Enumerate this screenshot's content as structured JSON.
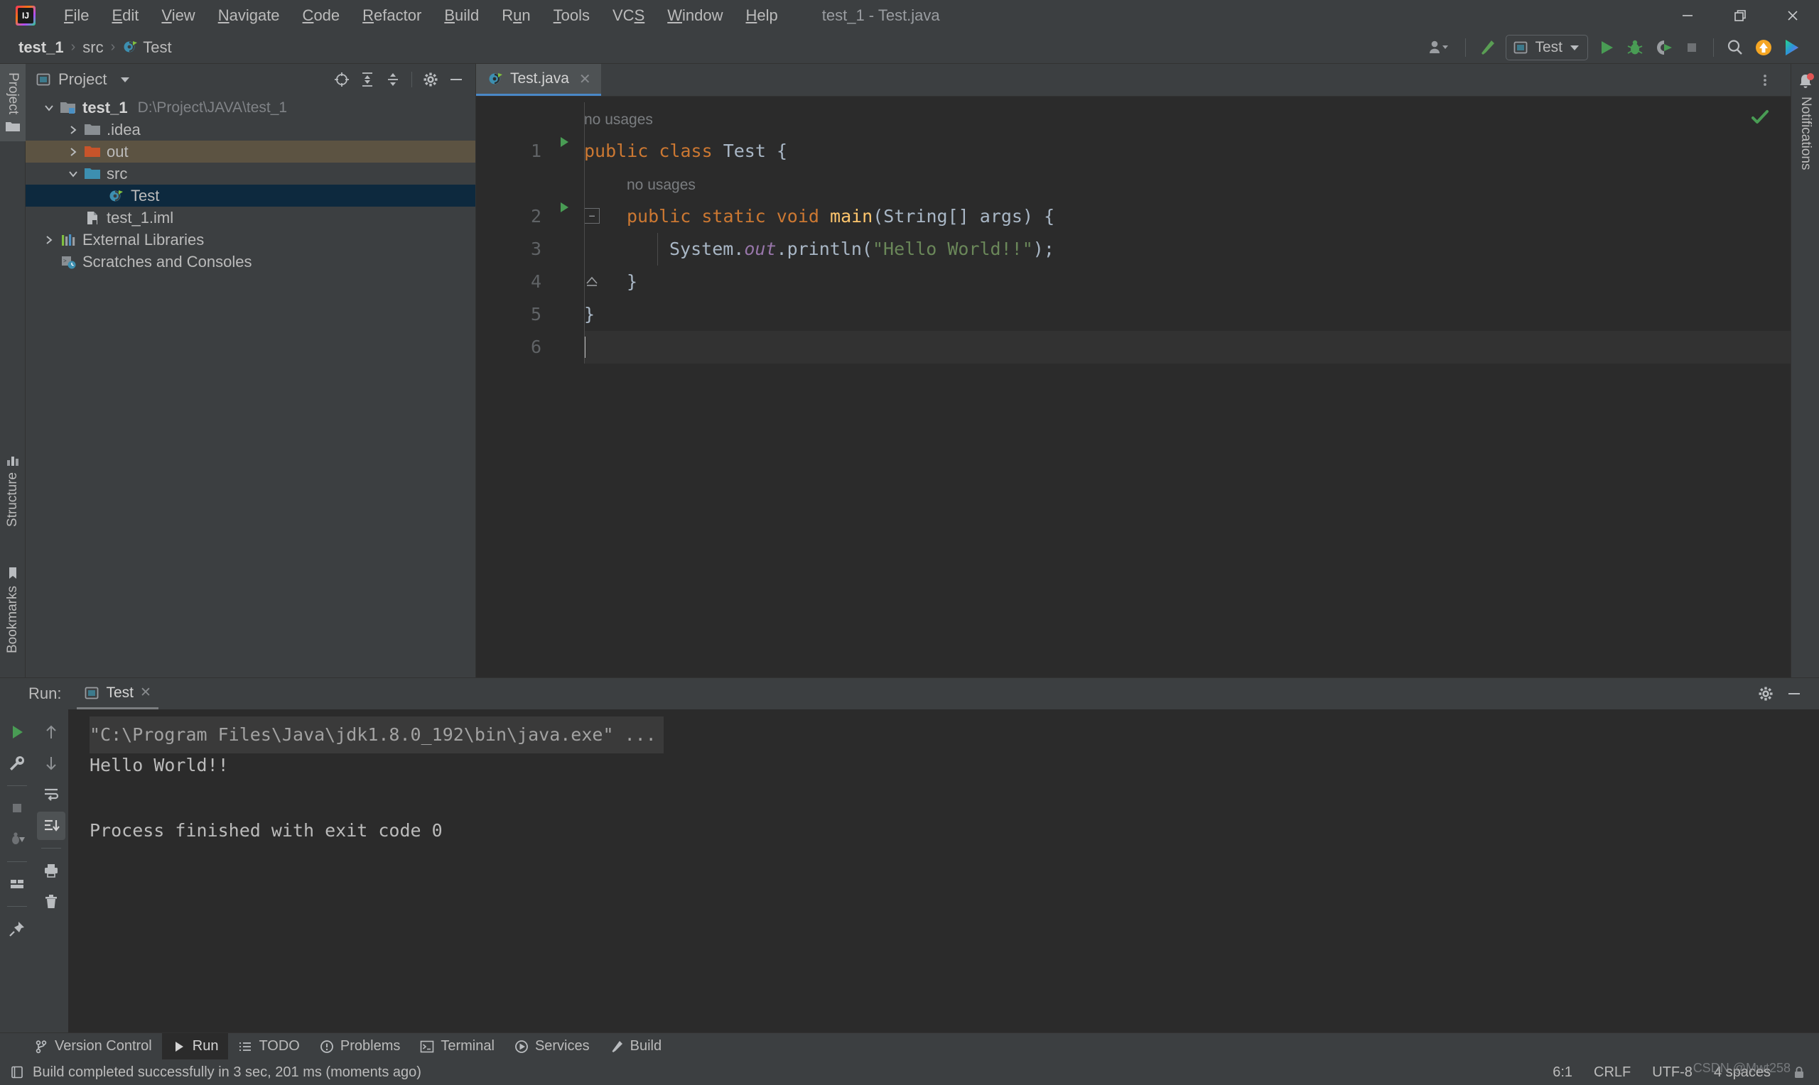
{
  "window": {
    "title": "test_1 - Test.java",
    "controls": {
      "minimize": "minimize-icon",
      "restore": "restore-icon",
      "close": "close-icon"
    },
    "logo_text": "IJ"
  },
  "menu": {
    "items": [
      {
        "label": "File",
        "mnemonic": "F"
      },
      {
        "label": "Edit",
        "mnemonic": "E"
      },
      {
        "label": "View",
        "mnemonic": "V"
      },
      {
        "label": "Navigate",
        "mnemonic": "N"
      },
      {
        "label": "Code",
        "mnemonic": "C"
      },
      {
        "label": "Refactor",
        "mnemonic": "R"
      },
      {
        "label": "Build",
        "mnemonic": "B"
      },
      {
        "label": "Run",
        "mnemonic": "u"
      },
      {
        "label": "Tools",
        "mnemonic": "T"
      },
      {
        "label": "VCS",
        "mnemonic": "S"
      },
      {
        "label": "Window",
        "mnemonic": "W"
      },
      {
        "label": "Help",
        "mnemonic": "H"
      }
    ]
  },
  "navbar": {
    "breadcrumbs": [
      {
        "label": "test_1",
        "bold": true,
        "icon": null
      },
      {
        "label": "src",
        "bold": false,
        "icon": null
      },
      {
        "label": "Test",
        "bold": false,
        "icon": "java-class-icon"
      }
    ],
    "separator": "›",
    "toolbar": {
      "account_icon": "user-account-icon",
      "account_chevron": "chevron-down-icon",
      "build_icon": "build-hammer-icon",
      "run_config": {
        "icon": "run-config-icon",
        "label": "Test",
        "chevron": "chevron-down-icon"
      },
      "run_icon": "run-play-icon",
      "debug_icon": "debug-bug-icon",
      "coverage_icon": "run-with-coverage-icon",
      "stop_icon": "stop-square-icon",
      "search_icon": "search-icon",
      "update_icon": "update-arrow-icon",
      "ide_icon": "ide-feature-icon"
    }
  },
  "stripes": {
    "left": [
      {
        "label": "Project",
        "icon": "project-icon",
        "active": true
      },
      {
        "label": "Structure",
        "icon": "structure-icon",
        "active": false
      },
      {
        "label": "Bookmarks",
        "icon": "bookmarks-icon",
        "active": false
      }
    ],
    "right": [
      {
        "label": "Notifications",
        "icon": "notifications-bell-icon",
        "badge": true
      }
    ]
  },
  "project_panel": {
    "title": "Project",
    "title_icon": "project-view-icon",
    "title_chevron": "chevron-down-icon",
    "tools": [
      {
        "name": "select-opened-file-icon",
        "title": "Select Opened File"
      },
      {
        "name": "expand-all-icon",
        "title": "Expand All"
      },
      {
        "name": "collapse-all-icon",
        "title": "Collapse All"
      },
      {
        "name": "settings-gear-icon",
        "title": "Options"
      },
      {
        "name": "hide-panel-icon",
        "title": "Hide"
      }
    ],
    "tree": [
      {
        "label": "test_1",
        "secondary": "D:\\Project\\JAVA\\test_1",
        "indent": 0,
        "twist": "expanded",
        "icon": "module-icon",
        "bold": true,
        "state": "normal"
      },
      {
        "label": ".idea",
        "secondary": "",
        "indent": 1,
        "twist": "collapsed",
        "icon": "folder-icon",
        "bold": false,
        "state": "normal"
      },
      {
        "label": "out",
        "secondary": "",
        "indent": 1,
        "twist": "collapsed",
        "icon": "folder-excluded-icon",
        "bold": false,
        "state": "hovered"
      },
      {
        "label": "src",
        "secondary": "",
        "indent": 1,
        "twist": "expanded",
        "icon": "folder-source-icon",
        "bold": false,
        "state": "normal"
      },
      {
        "label": "Test",
        "secondary": "",
        "indent": 2,
        "twist": "none",
        "icon": "java-class-icon",
        "bold": false,
        "state": "selected"
      },
      {
        "label": "test_1.iml",
        "secondary": "",
        "indent": 1,
        "twist": "none",
        "icon": "iml-file-icon",
        "bold": false,
        "state": "normal"
      },
      {
        "label": "External Libraries",
        "secondary": "",
        "indent": 0,
        "twist": "collapsed",
        "icon": "libraries-icon",
        "bold": false,
        "state": "normal"
      },
      {
        "label": "Scratches and Consoles",
        "secondary": "",
        "indent": 0,
        "twist": "none",
        "icon": "scratches-icon",
        "bold": false,
        "state": "normal"
      }
    ]
  },
  "editor": {
    "tabs": [
      {
        "label": "Test.java",
        "icon": "java-class-icon",
        "active": true,
        "close": "close-icon"
      }
    ],
    "options_icon": "more-vertical-icon",
    "inspection_status": "ok-check-icon",
    "lines": [
      {
        "number": "",
        "type": "hint",
        "text": "no usages",
        "indent": 0,
        "runmark": false,
        "fold": "none",
        "current": false
      },
      {
        "number": "1",
        "type": "code",
        "indent": 0,
        "runmark": true,
        "fold": "none",
        "current": false,
        "tokens": [
          {
            "t": "public",
            "c": "kw"
          },
          {
            "t": " ",
            "c": "id"
          },
          {
            "t": "class",
            "c": "kw"
          },
          {
            "t": " ",
            "c": "id"
          },
          {
            "t": "Test",
            "c": "id"
          },
          {
            "t": " {",
            "c": "id"
          }
        ]
      },
      {
        "number": "",
        "type": "hint",
        "text": "no usages",
        "indent": 1,
        "runmark": false,
        "fold": "none",
        "current": false
      },
      {
        "number": "2",
        "type": "code",
        "indent": 1,
        "runmark": true,
        "fold": "start",
        "current": false,
        "tokens": [
          {
            "t": "public",
            "c": "kw"
          },
          {
            "t": " ",
            "c": "id"
          },
          {
            "t": "static",
            "c": "kw"
          },
          {
            "t": " ",
            "c": "id"
          },
          {
            "t": "void",
            "c": "kw"
          },
          {
            "t": " ",
            "c": "id"
          },
          {
            "t": "main",
            "c": "mth"
          },
          {
            "t": "(String[] args) {",
            "c": "id"
          }
        ]
      },
      {
        "number": "3",
        "type": "code",
        "indent": 2,
        "runmark": false,
        "fold": "none",
        "current": false,
        "tokens": [
          {
            "t": "System.",
            "c": "id"
          },
          {
            "t": "out",
            "c": "fld"
          },
          {
            "t": ".println(",
            "c": "id"
          },
          {
            "t": "\"Hello World!!\"",
            "c": "str"
          },
          {
            "t": ");",
            "c": "id"
          }
        ]
      },
      {
        "number": "4",
        "type": "code",
        "indent": 1,
        "runmark": false,
        "fold": "end",
        "current": false,
        "tokens": [
          {
            "t": "}",
            "c": "id"
          }
        ]
      },
      {
        "number": "5",
        "type": "code",
        "indent": 0,
        "runmark": false,
        "fold": "none",
        "current": false,
        "tokens": [
          {
            "t": "}",
            "c": "id"
          }
        ]
      },
      {
        "number": "6",
        "type": "caret",
        "indent": 0,
        "runmark": false,
        "fold": "none",
        "current": true,
        "tokens": []
      }
    ]
  },
  "run_window": {
    "label": "Run:",
    "tab": {
      "label": "Test",
      "icon": "run-config-icon",
      "close": "close-icon"
    },
    "header_tools": [
      {
        "name": "settings-gear-icon",
        "title": "Settings"
      },
      {
        "name": "hide-panel-icon",
        "title": "Hide"
      }
    ],
    "left_toolbar": [
      {
        "name": "rerun-icon",
        "active": false
      },
      {
        "name": "edit-configuration-wrench-icon",
        "active": false
      },
      {
        "name": "stop-square-icon",
        "active": false
      },
      {
        "name": "dump-threads-icon",
        "active": false
      },
      {
        "name": "layout-icon",
        "active": false
      },
      {
        "name": "pin-tab-icon",
        "active": false
      }
    ],
    "right_toolbar": [
      {
        "name": "up-arrow-icon",
        "active": false
      },
      {
        "name": "down-arrow-icon",
        "active": false
      },
      {
        "name": "soft-wrap-icon",
        "active": false
      },
      {
        "name": "scroll-to-end-icon",
        "active": true
      },
      {
        "name": "print-icon",
        "active": false
      },
      {
        "name": "clear-all-trash-icon",
        "active": false
      }
    ],
    "console": [
      {
        "text": "\"C:\\Program Files\\Java\\jdk1.8.0_192\\bin\\java.exe\" ...",
        "style": "command"
      },
      {
        "text": "Hello World!!",
        "style": "output"
      },
      {
        "text": "",
        "style": "output"
      },
      {
        "text": "Process finished with exit code 0",
        "style": "output"
      }
    ]
  },
  "tool_window_bar": [
    {
      "label": "Version Control",
      "icon": "version-control-icon",
      "active": false
    },
    {
      "label": "Run",
      "icon": "run-play-icon",
      "active": true
    },
    {
      "label": "TODO",
      "icon": "todo-list-icon",
      "active": false
    },
    {
      "label": "Problems",
      "icon": "problems-icon",
      "active": false
    },
    {
      "label": "Terminal",
      "icon": "terminal-icon",
      "active": false
    },
    {
      "label": "Services",
      "icon": "services-icon",
      "active": false
    },
    {
      "label": "Build",
      "icon": "build-hammer-icon",
      "active": false
    }
  ],
  "status_bar": {
    "icon": "build-status-icon",
    "message": "Build completed successfully in 3 sec, 201 ms (moments ago)",
    "caret_position": "6:1",
    "line_separator": "CRLF",
    "encoding": "UTF-8",
    "indent": "4 spaces",
    "lock_icon": "read-only-lock-icon",
    "watermark": "CSDN @Mwt258"
  },
  "colors": {
    "accent_blue": "#4a88c7",
    "selection_blue": "#0d293e",
    "hover_brown": "#5c5342",
    "panel_bg": "#3c3f41",
    "editor_bg": "#2b2b2b",
    "keyword_orange": "#cc7832",
    "string_green": "#6a8759",
    "method_yellow": "#ffc66d",
    "field_purple": "#9876aa",
    "identifier": "#a9b7c6",
    "run_green": "#499c54",
    "badge_red": "#e05555",
    "update_orange": "#f5a623"
  }
}
